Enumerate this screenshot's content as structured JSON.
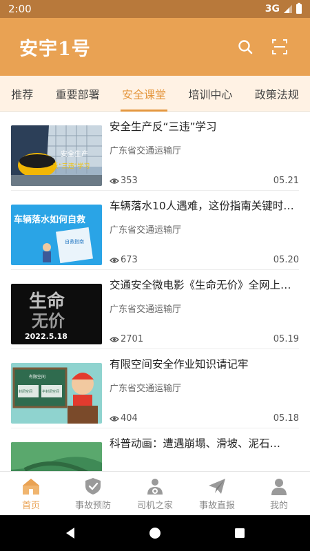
{
  "status_bar": {
    "time": "2:00",
    "network": "3G"
  },
  "header": {
    "title": "安宇1号"
  },
  "tabs": [
    {
      "label": "推荐"
    },
    {
      "label": "重要部署"
    },
    {
      "label": "安全课堂"
    },
    {
      "label": "培训中心"
    },
    {
      "label": "政策法规"
    }
  ],
  "articles": [
    {
      "title": "安全生产反“三违”学习",
      "source": "广东省交通运输厅",
      "views": "353",
      "date": "05.21",
      "thumb_text": [
        "安全生产",
        "反“三违”学习"
      ]
    },
    {
      "title": "车辆落水10人遇难，这份指南关键时…",
      "source": "广东省交通运输厅",
      "views": "673",
      "date": "05.20",
      "thumb_text": [
        "车辆落水如何自救",
        "自救指南"
      ]
    },
    {
      "title": "交通安全微电影《生命无价》全网上…",
      "source": "广东省交通运输厅",
      "views": "2701",
      "date": "05.19",
      "thumb_text": [
        "生命",
        "无价",
        "2022.5.18"
      ]
    },
    {
      "title": "有限空间安全作业知识请记牢",
      "source": "广东省交通运输厅",
      "views": "404",
      "date": "05.18",
      "thumb_text": [
        "有限空间",
        "封闭空间",
        "半封闭空间"
      ]
    },
    {
      "title": "科普动画：遭遇崩塌、滑坡、泥石…",
      "source": "",
      "views": "",
      "date": ""
    }
  ],
  "bottom_nav": [
    {
      "label": "首页"
    },
    {
      "label": "事故预防"
    },
    {
      "label": "司机之家"
    },
    {
      "label": "事故直报"
    },
    {
      "label": "我的"
    }
  ],
  "colors": {
    "primary": "#e9a253",
    "status_bar": "#b8793b",
    "tab_bg": "#fff2e4",
    "active": "#e4973f"
  }
}
